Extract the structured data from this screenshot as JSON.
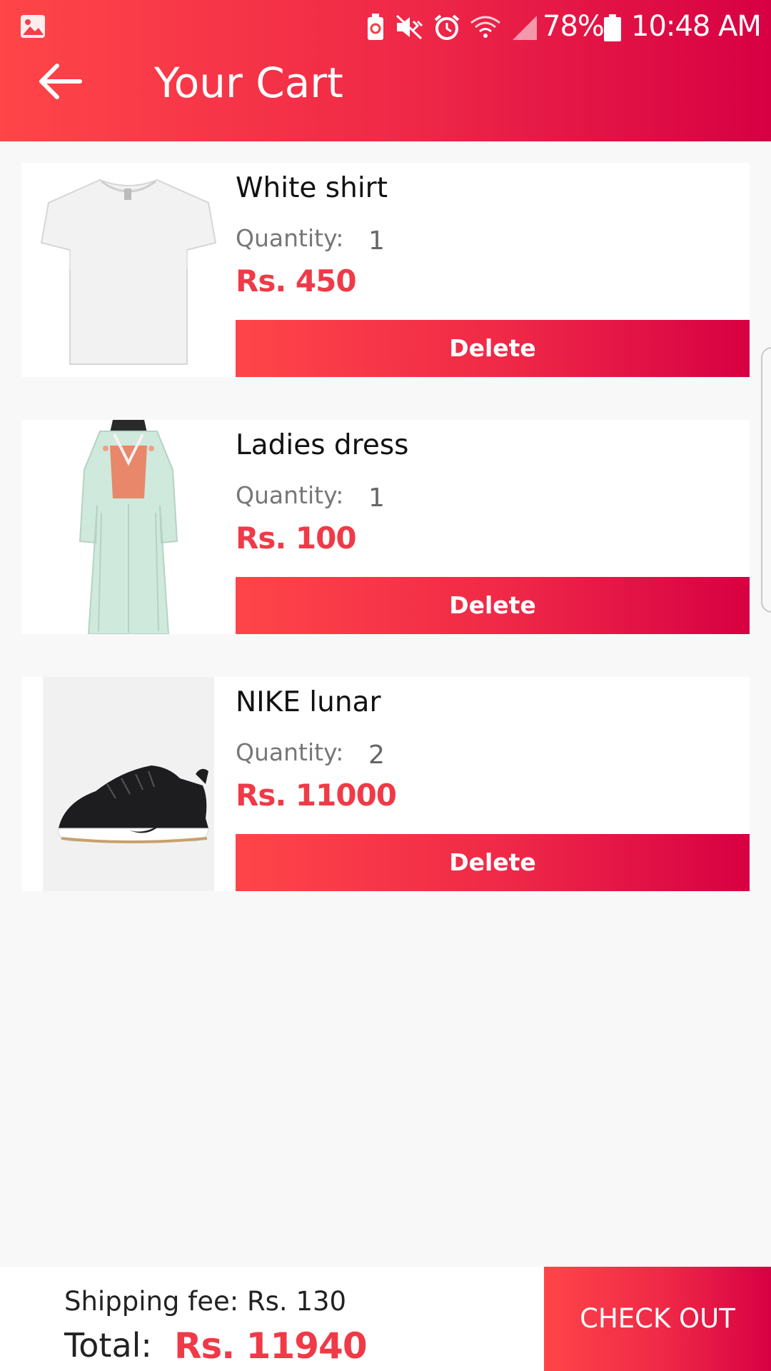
{
  "status_bar": {
    "battery": "78%",
    "time": "10:48 AM",
    "icons": [
      "gallery-icon",
      "battery-saver-icon",
      "mute-icon",
      "alarm-icon",
      "wifi-icon",
      "signal-icon",
      "battery-icon"
    ]
  },
  "header": {
    "title": "Your Cart",
    "back_icon": "arrow-left-icon"
  },
  "cart": {
    "items": [
      {
        "name": "White shirt",
        "quantity_label": "Quantity:",
        "quantity": "1",
        "price": "Rs. 450",
        "delete_label": "Delete"
      },
      {
        "name": "Ladies dress",
        "quantity_label": "Quantity:",
        "quantity": "1",
        "price": "Rs. 100",
        "delete_label": "Delete"
      },
      {
        "name": "NIKE lunar",
        "quantity_label": "Quantity:",
        "quantity": "2",
        "price": "Rs. 11000",
        "delete_label": "Delete"
      }
    ]
  },
  "footer": {
    "shipping": "Shipping fee: Rs. 130",
    "total_label": "Total:",
    "total_value": "Rs. 11940",
    "checkout_label": "CHECK OUT"
  },
  "colors": {
    "accent_start": "#ff4548",
    "accent_end": "#d70043",
    "price": "#f03a47"
  }
}
